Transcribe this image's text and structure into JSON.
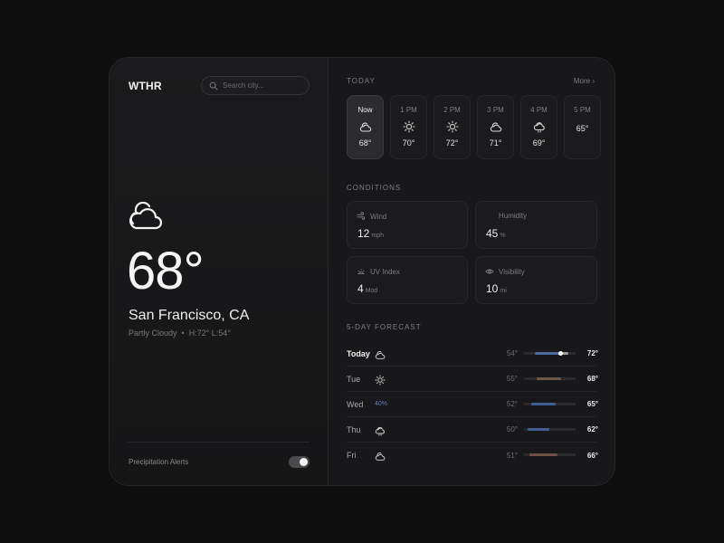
{
  "app": {
    "brand": "WTHR"
  },
  "search": {
    "placeholder": "Search city..."
  },
  "current": {
    "icon": "partly-cloudy-icon",
    "temperature": "68°",
    "city": "San Francisco, CA",
    "condition": "Partly Cloudy",
    "separator": "•",
    "hi_lo": "H:72° L:54°"
  },
  "alerts": {
    "label": "Precipitation Alerts",
    "enabled": true
  },
  "today": {
    "section_label": "TODAY",
    "more_label": "More",
    "hours": [
      {
        "label": "Now",
        "icon": "cloud-sun-icon",
        "temp": "68°",
        "active": true
      },
      {
        "label": "1 PM",
        "icon": "sun-icon",
        "temp": "70°",
        "active": false
      },
      {
        "label": "2 PM",
        "icon": "sun-icon",
        "temp": "72°",
        "active": false
      },
      {
        "label": "3 PM",
        "icon": "cloud-sun-icon",
        "temp": "71°",
        "active": false
      },
      {
        "label": "4 PM",
        "icon": "cloud-sun-rain-icon",
        "temp": "69°",
        "active": false
      },
      {
        "label": "5 PM",
        "icon": "",
        "temp": "65°",
        "active": false
      }
    ]
  },
  "conditions": {
    "section_label": "CONDITIONS",
    "items": [
      {
        "label": "Wind",
        "icon": "wind-icon",
        "value": "12",
        "unit": "mph"
      },
      {
        "label": "Humidity",
        "icon": "",
        "value": "45",
        "unit": "%"
      },
      {
        "label": "UV Index",
        "icon": "uv-sun-icon",
        "value": "4",
        "unit": "Mod"
      },
      {
        "label": "Visibility",
        "icon": "eye-icon",
        "value": "10",
        "unit": "mi"
      }
    ]
  },
  "forecast": {
    "section_label": "5-DAY FORECAST",
    "scale_min": 48,
    "scale_max": 76,
    "days": [
      {
        "day": "Today",
        "icon": "cloud-sun-icon",
        "precip": "",
        "low": "54°",
        "high": "72°",
        "low_v": 54,
        "high_v": 72,
        "current_v": 68,
        "color": "#4a6aa3"
      },
      {
        "day": "Tue",
        "icon": "sun-icon",
        "precip": "",
        "low": "55°",
        "high": "68°",
        "low_v": 55,
        "high_v": 68,
        "color": "#6b5a4c"
      },
      {
        "day": "Wed",
        "icon": "",
        "precip": "40%",
        "low": "52°",
        "high": "65°",
        "low_v": 52,
        "high_v": 65,
        "color": "#415f96"
      },
      {
        "day": "Thu",
        "icon": "cloud-sun-rain-icon",
        "precip": "",
        "low": "50°",
        "high": "62°",
        "low_v": 50,
        "high_v": 62,
        "color": "#415f96"
      },
      {
        "day": "Fri",
        "icon": "cloud-sun-icon",
        "precip": "",
        "low": "51°",
        "high": "66°",
        "low_v": 51,
        "high_v": 66,
        "color": "#6e5044"
      }
    ]
  }
}
